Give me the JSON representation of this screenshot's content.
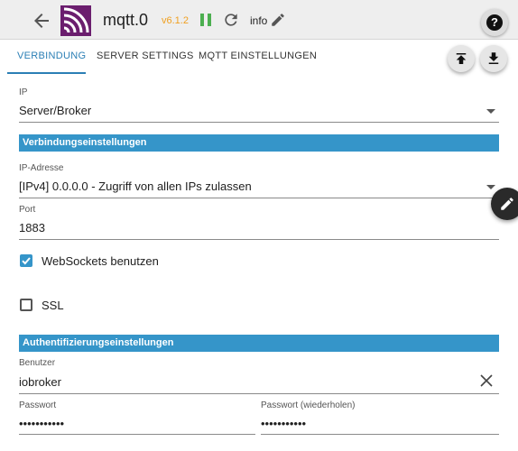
{
  "header": {
    "title": "mqtt.0",
    "version": "v6.1.2",
    "info_label": "info",
    "back_icon": "arrow-left-icon",
    "logo_icon": "mqtt-logo",
    "pause_icon": "pause-icon",
    "reload_icon": "reload-icon",
    "edit_icon": "pencil-icon",
    "help_icon": "help-icon",
    "colors": {
      "version": "#f0a020",
      "pause": "#4caf50",
      "logo": "#6b1e6e"
    }
  },
  "tabs": [
    {
      "label": "VERBINDUNG",
      "active": true
    },
    {
      "label": "SERVER SETTINGS",
      "active": false
    },
    {
      "label": "MQTT EINSTELLUNGEN",
      "active": false
    }
  ],
  "actions": {
    "upload_icon": "upload-icon",
    "download_icon": "download-icon",
    "edit_fab_icon": "pencil-icon"
  },
  "form": {
    "ip": {
      "label": "IP",
      "value": "Server/Broker"
    },
    "section_connection": "Verbindungseinstellungen",
    "ip_address": {
      "label": "IP-Adresse",
      "value": "[IPv4] 0.0.0.0 - Zugriff von allen IPs zulassen"
    },
    "port": {
      "label": "Port",
      "value": "1883"
    },
    "websockets": {
      "label": "WebSockets benutzen",
      "checked": true
    },
    "ssl": {
      "label": "SSL",
      "checked": false
    },
    "section_auth": "Authentifizierungseinstellungen",
    "user": {
      "label": "Benutzer",
      "value": "iobroker"
    },
    "password": {
      "label": "Passwort",
      "value": "•••••••••••"
    },
    "password_repeat": {
      "label": "Passwort (wiederholen)",
      "value": "•••••••••••"
    }
  },
  "colors": {
    "accent": "#3595c9",
    "tab_active": "#2b7fb5"
  }
}
